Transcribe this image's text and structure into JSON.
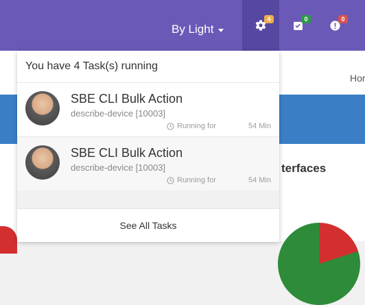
{
  "header": {
    "user_label": "By Light",
    "badges": {
      "tasks": "4",
      "checks": "0",
      "alerts": "0"
    },
    "colors": {
      "bar": "#6b59b7",
      "task_badge": "#f0ad4e",
      "check_badge": "#2e9b45",
      "alert_badge": "#d9534f"
    }
  },
  "background": {
    "home_link": "Hor",
    "section_title": "terfaces"
  },
  "tasks_dropdown": {
    "header": "You have 4 Task(s) running",
    "items": [
      {
        "title": "SBE CLI Bulk Action",
        "subtitle": "describe-device [10003]",
        "status": "Running for",
        "duration": "54 Min"
      },
      {
        "title": "SBE CLI Bulk Action",
        "subtitle": "describe-device [10003]",
        "status": "Running for",
        "duration": "54 Min"
      }
    ],
    "footer": "See All Tasks"
  }
}
